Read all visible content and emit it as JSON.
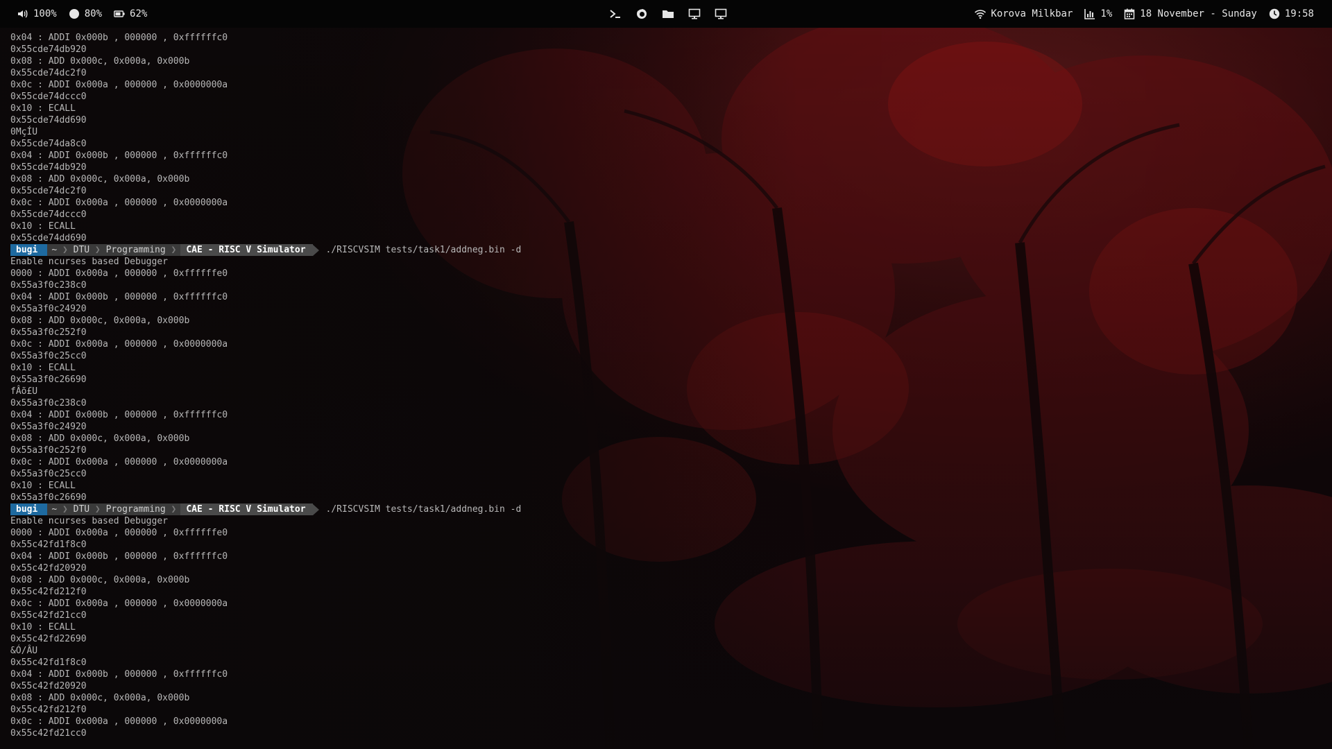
{
  "topbar": {
    "volume": "100%",
    "brightness": "80%",
    "battery": "62%",
    "wifi": "Korova Milkbar",
    "cpu": "1%",
    "date": "18 November - Sunday",
    "time": "19:58",
    "icons": [
      "volume-icon",
      "brightness-icon",
      "battery-icon",
      "terminal-icon",
      "firefox-icon",
      "folder-icon",
      "display-icon",
      "display-icon",
      "wifi-icon",
      "chart-icon",
      "calendar-icon",
      "clock-icon"
    ]
  },
  "terminal": {
    "prompt": {
      "user": "bugi",
      "home": "~",
      "dirs": [
        "DTU",
        "Programming"
      ],
      "current": "CAE - RISC V Simulator",
      "command": "./RISCVSIM tests/task1/addneg.bin -d"
    },
    "lines": [
      {
        "type": "out",
        "text": "0x04 : ADDI 0x000b , 000000 , 0xffffffc0"
      },
      {
        "type": "out",
        "text": "0x55cde74db920"
      },
      {
        "type": "out",
        "text": "0x08 : ADD 0x000c, 0x000a, 0x000b"
      },
      {
        "type": "out",
        "text": "0x55cde74dc2f0"
      },
      {
        "type": "out",
        "text": "0x0c : ADDI 0x000a , 000000 , 0x0000000a"
      },
      {
        "type": "out",
        "text": "0x55cde74dccc0"
      },
      {
        "type": "out",
        "text": "0x10 : ECALL"
      },
      {
        "type": "out",
        "text": "0x55cde74dd690"
      },
      {
        "type": "out",
        "text": "0MçÍU"
      },
      {
        "type": "out",
        "text": "0x55cde74da8c0"
      },
      {
        "type": "out",
        "text": "0x04 : ADDI 0x000b , 000000 , 0xffffffc0"
      },
      {
        "type": "out",
        "text": "0x55cde74db920"
      },
      {
        "type": "out",
        "text": "0x08 : ADD 0x000c, 0x000a, 0x000b"
      },
      {
        "type": "out",
        "text": "0x55cde74dc2f0"
      },
      {
        "type": "out",
        "text": "0x0c : ADDI 0x000a , 000000 , 0x0000000a"
      },
      {
        "type": "out",
        "text": "0x55cde74dccc0"
      },
      {
        "type": "out",
        "text": "0x10 : ECALL"
      },
      {
        "type": "out",
        "text": "0x55cde74dd690"
      },
      {
        "type": "prompt"
      },
      {
        "type": "out",
        "text": "Enable ncurses based Debugger"
      },
      {
        "type": "out",
        "text": "0000 : ADDI 0x000a , 000000 , 0xffffffe0"
      },
      {
        "type": "out",
        "text": "0x55a3f0c238c0"
      },
      {
        "type": "out",
        "text": "0x04 : ADDI 0x000b , 000000 , 0xffffffc0"
      },
      {
        "type": "out",
        "text": "0x55a3f0c24920"
      },
      {
        "type": "out",
        "text": "0x08 : ADD 0x000c, 0x000a, 0x000b"
      },
      {
        "type": "out",
        "text": "0x55a3f0c252f0"
      },
      {
        "type": "out",
        "text": "0x0c : ADDI 0x000a , 000000 , 0x0000000a"
      },
      {
        "type": "out",
        "text": "0x55a3f0c25cc0"
      },
      {
        "type": "out",
        "text": "0x10 : ECALL"
      },
      {
        "type": "out",
        "text": "0x55a3f0c26690"
      },
      {
        "type": "out",
        "text": "fÂõ£U"
      },
      {
        "type": "out",
        "text": "0x55a3f0c238c0"
      },
      {
        "type": "out",
        "text": "0x04 : ADDI 0x000b , 000000 , 0xffffffc0"
      },
      {
        "type": "out",
        "text": "0x55a3f0c24920"
      },
      {
        "type": "out",
        "text": "0x08 : ADD 0x000c, 0x000a, 0x000b"
      },
      {
        "type": "out",
        "text": "0x55a3f0c252f0"
      },
      {
        "type": "out",
        "text": "0x0c : ADDI 0x000a , 000000 , 0x0000000a"
      },
      {
        "type": "out",
        "text": "0x55a3f0c25cc0"
      },
      {
        "type": "out",
        "text": "0x10 : ECALL"
      },
      {
        "type": "out",
        "text": "0x55a3f0c26690"
      },
      {
        "type": "prompt"
      },
      {
        "type": "out",
        "text": "Enable ncurses based Debugger"
      },
      {
        "type": "out",
        "text": "0000 : ADDI 0x000a , 000000 , 0xffffffe0"
      },
      {
        "type": "out",
        "text": "0x55c42fd1f8c0"
      },
      {
        "type": "out",
        "text": "0x04 : ADDI 0x000b , 000000 , 0xffffffc0"
      },
      {
        "type": "out",
        "text": "0x55c42fd20920"
      },
      {
        "type": "out",
        "text": "0x08 : ADD 0x000c, 0x000a, 0x000b"
      },
      {
        "type": "out",
        "text": "0x55c42fd212f0"
      },
      {
        "type": "out",
        "text": "0x0c : ADDI 0x000a , 000000 , 0x0000000a"
      },
      {
        "type": "out",
        "text": "0x55c42fd21cc0"
      },
      {
        "type": "out",
        "text": "0x10 : ECALL"
      },
      {
        "type": "out",
        "text": "0x55c42fd22690"
      },
      {
        "type": "out",
        "text": "&Ó/ÂU"
      },
      {
        "type": "out",
        "text": "0x55c42fd1f8c0"
      },
      {
        "type": "out",
        "text": "0x04 : ADDI 0x000b , 000000 , 0xffffffc0"
      },
      {
        "type": "out",
        "text": "0x55c42fd20920"
      },
      {
        "type": "out",
        "text": "0x08 : ADD 0x000c, 0x000a, 0x000b"
      },
      {
        "type": "out",
        "text": "0x55c42fd212f0"
      },
      {
        "type": "out",
        "text": "0x0c : ADDI 0x000a , 000000 , 0x0000000a"
      },
      {
        "type": "out",
        "text": "0x55c42fd21cc0"
      }
    ]
  },
  "colors": {
    "prompt_user_bg": "#1e6aa0",
    "prompt_path_bg": "#3a3a3a",
    "terminal_text": "#b8b8b8",
    "wallpaper_accent": "#8a1414"
  }
}
